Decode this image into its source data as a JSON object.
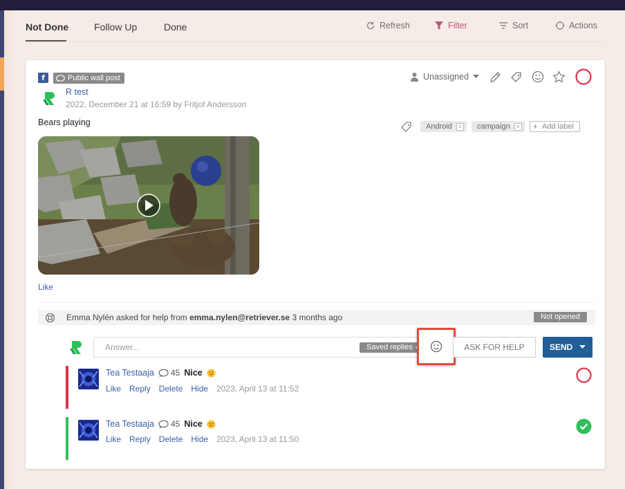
{
  "tabs": [
    {
      "label": "Not Done",
      "active": true
    },
    {
      "label": "Follow Up",
      "active": false
    },
    {
      "label": "Done",
      "active": false
    }
  ],
  "toolbar": {
    "refresh": "Refresh",
    "filter": "Filter",
    "sort": "Sort",
    "actions": "Actions"
  },
  "post": {
    "network_icon": "f",
    "type_badge": "Public wall post",
    "author": "R test",
    "meta": "2022, December 21 at 16:59 by Fritjof Andersson",
    "text": "Bears playing",
    "like": "Like",
    "assignment": "Unassigned",
    "labels": [
      "Android",
      "campaign"
    ],
    "add_label": "Add label"
  },
  "help_request": {
    "prefix": "Emma Nylén asked for help from ",
    "email": "emma.nylen@retriever.se",
    "suffix": " 3 months ago",
    "status": "Not opened"
  },
  "reply": {
    "placeholder": "Answer...",
    "saved_replies": "Saved replies",
    "ask_for_help": "ASK FOR HELP",
    "send": "SEND"
  },
  "comments": [
    {
      "author": "Tea Testaaja",
      "count": "45",
      "body": "Nice",
      "like": "Like",
      "reply": "Reply",
      "delete": "Delete",
      "hide": "Hide",
      "date": "2023, April 13 at 11:52",
      "state": "open"
    },
    {
      "author": "Tea Testaaja",
      "count": "45",
      "body": "Nice",
      "like": "Like",
      "reply": "Reply",
      "delete": "Delete",
      "hide": "Hide",
      "date": "2023, April 13 at 11:50",
      "state": "done"
    }
  ],
  "colors": {
    "accent_blue": "#1f5e96",
    "link_blue": "#3a5ea8",
    "status_red": "#e0324b",
    "status_green": "#2fbf5a",
    "filter_pink": "#c0557a",
    "highlight_red": "#e34b3b"
  }
}
